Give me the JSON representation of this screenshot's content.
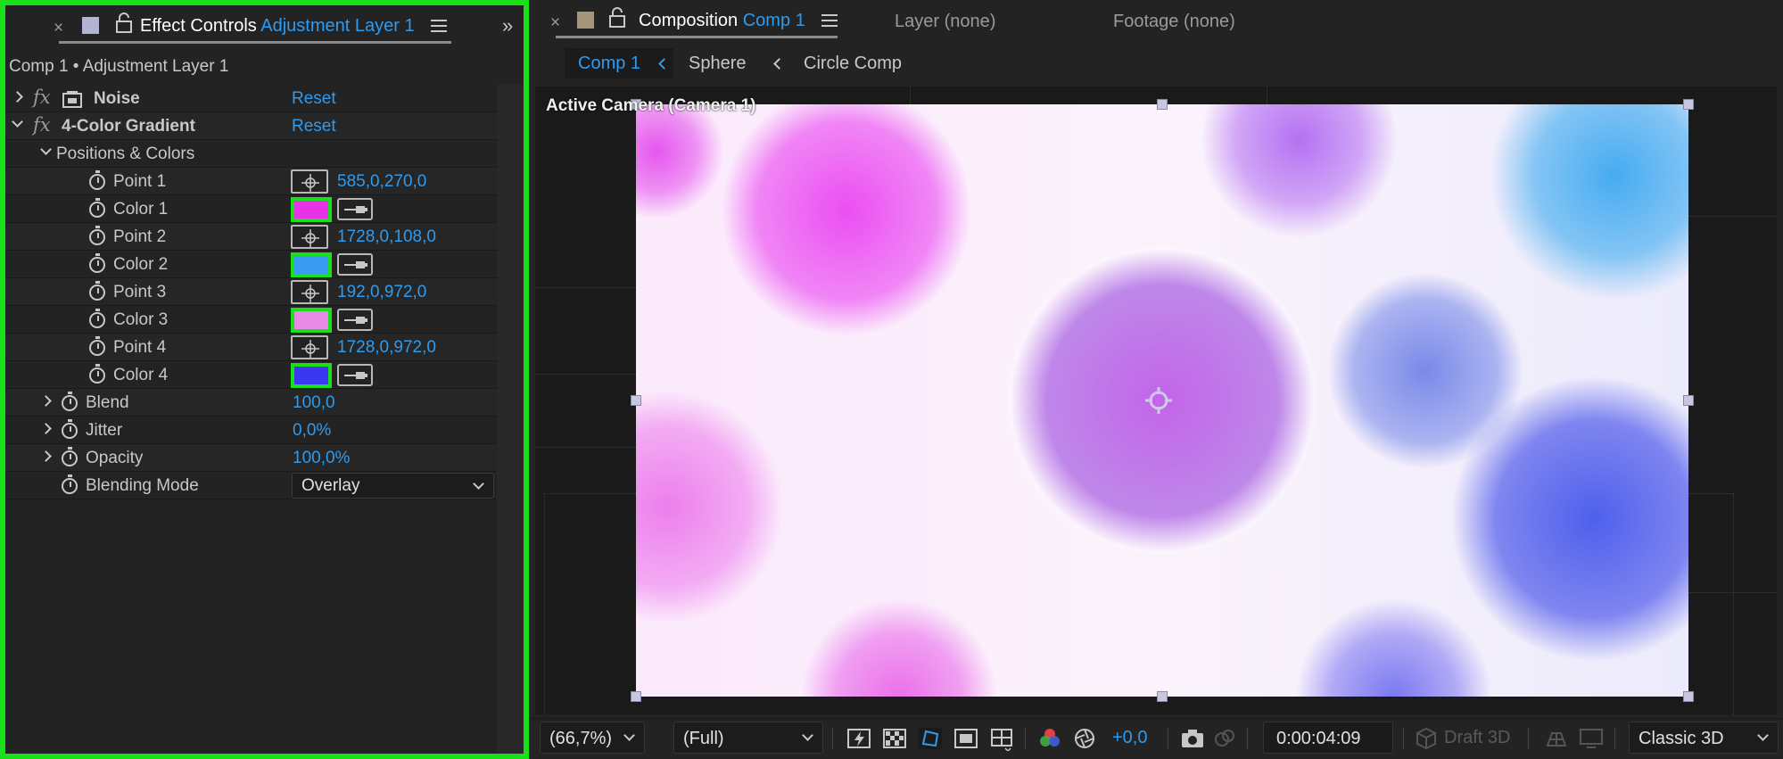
{
  "effect_controls": {
    "close_glyph": "×",
    "title_prefix": "Effect Controls",
    "title_layer": "Adjustment Layer 1",
    "expand_glyph": "»",
    "subtitle": "Comp 1 • Adjustment Layer 1",
    "effects": [
      {
        "name": "Noise",
        "reset": "Reset"
      },
      {
        "name": "4-Color Gradient",
        "reset": "Reset"
      }
    ],
    "group": "Positions & Colors",
    "points": [
      {
        "label": "Point 1",
        "value": "585,0,270,0"
      },
      {
        "label": "Point 2",
        "value": "1728,0,108,0"
      },
      {
        "label": "Point 3",
        "value": "192,0,972,0"
      },
      {
        "label": "Point 4",
        "value": "1728,0,972,0"
      }
    ],
    "colors": [
      {
        "label": "Color 1",
        "hex": "#e832e8"
      },
      {
        "label": "Color 2",
        "hex": "#3a9cf0"
      },
      {
        "label": "Color 3",
        "hex": "#e98ae6"
      },
      {
        "label": "Color 4",
        "hex": "#3b38f2"
      }
    ],
    "blend": {
      "label": "Blend",
      "value": "100,0"
    },
    "jitter": {
      "label": "Jitter",
      "value": "0,0%"
    },
    "opacity": {
      "label": "Opacity",
      "value": "100,0%"
    },
    "blending_mode": {
      "label": "Blending Mode",
      "value": "Overlay"
    }
  },
  "composition": {
    "close_glyph": "×",
    "title_prefix": "Composition",
    "title_comp": "Comp 1",
    "tabs": [
      "Layer (none)",
      "Footage (none)"
    ],
    "breadcrumb": [
      "Comp 1",
      "Sphere",
      "Circle Comp"
    ],
    "camera_label": "Active Camera (Camera 1)"
  },
  "viewer_bar": {
    "zoom": "(66,7%)",
    "resolution": "(Full)",
    "exposure": "+0,0",
    "timecode": "0:00:04:09",
    "draft_3d": "Draft 3D",
    "renderer": "Classic 3D"
  },
  "colors": {
    "accent": "#2d9bf0",
    "highlight": "#19e019",
    "panel": "#232323"
  }
}
